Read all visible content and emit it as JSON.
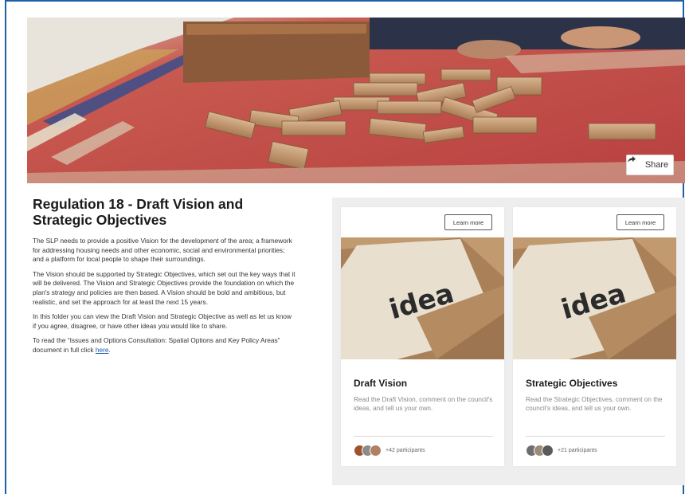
{
  "hero": {
    "share_label": "Share"
  },
  "intro": {
    "title": "Regulation 18 - Draft Vision and Strategic Objectives",
    "paragraphs": [
      "The SLP needs to provide a positive Vision for the development of the area; a framework for addressing housing needs and other economic, social and environmental priorities; and a platform for local people to shape their surroundings.",
      "The Vision should be supported by Strategic Objectives, which set out the key ways that it will be delivered. The Vision and Strategic Objectives provide the foundation on which the plan's strategy and policies are then based. A Vision should be bold and ambitious, but realistic, and set the approach for at least the next 15 years.",
      "In this folder you can view the Draft Vision and Strategic Objective as well as let us know if you agree, disagree, or have other ideas you would like to share."
    ],
    "last_paragraph_prefix": "To read the “Issues and Options Consultation: Spatial Options and Key Policy Areas” document in full click ",
    "link_text": "here",
    "last_paragraph_suffix": "."
  },
  "cards": [
    {
      "learn_more": "Learn more",
      "image_word": "idea",
      "title": "Draft Vision",
      "description": "Read the Draft Vision, comment on the council's ideas, and tell us your own.",
      "participants": "+42 participants",
      "avatar_colors": [
        "#a0522d",
        "#8b8b8b",
        "#b08060"
      ]
    },
    {
      "learn_more": "Learn more",
      "image_word": "idea",
      "title": "Strategic Objectives",
      "description": "Read the Strategic Objectives, comment on the council's ideas, and tell us your own.",
      "participants": "+21 participants",
      "avatar_colors": [
        "#6e6e6e",
        "#9c8a78",
        "#5a5a5a"
      ]
    }
  ],
  "colors": {
    "frame_border": "#1f5fa8",
    "link": "#1a56b3",
    "panel_bg": "#eeeeee"
  }
}
